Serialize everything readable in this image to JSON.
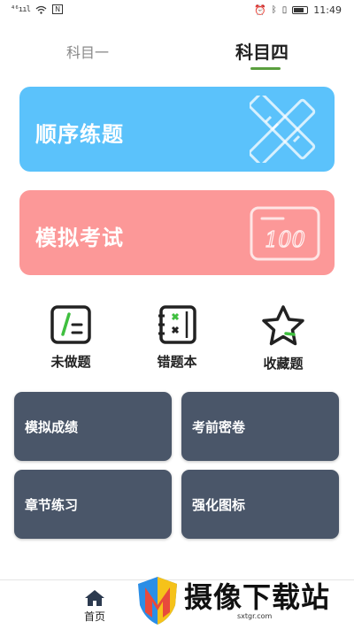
{
  "status_bar": {
    "signal_text": "⁴⁶ııl",
    "wifi_icon": "wifi-icon",
    "nfc_text": "N",
    "time": "11:49"
  },
  "tabs": [
    {
      "label": "科目一",
      "active": false
    },
    {
      "label": "科目四",
      "active": true
    }
  ],
  "accent_color": "#5a9f3e",
  "cards": {
    "sequential": {
      "label": "顺序练题",
      "color": "#5bc2fb",
      "icon": "pencil-ruler-icon"
    },
    "mock_exam": {
      "label": "模拟考试",
      "color": "#fc9898",
      "icon": "score-board-icon",
      "icon_text": "100"
    }
  },
  "quick_actions": [
    {
      "label": "未做题",
      "icon": "note-edit-icon"
    },
    {
      "label": "错题本",
      "icon": "wrong-book-icon"
    },
    {
      "label": "收藏题",
      "icon": "star-icon"
    }
  ],
  "grid_buttons": [
    {
      "label": "模拟成绩"
    },
    {
      "label": "考前密卷"
    },
    {
      "label": "章节练习"
    },
    {
      "label": "强化图标"
    }
  ],
  "grid_color": "#4a5669",
  "bottom_nav": {
    "home_label": "首页",
    "home_icon": "home-icon"
  },
  "watermark": {
    "text": "摄像下载站",
    "url": "sxtgr.com"
  }
}
